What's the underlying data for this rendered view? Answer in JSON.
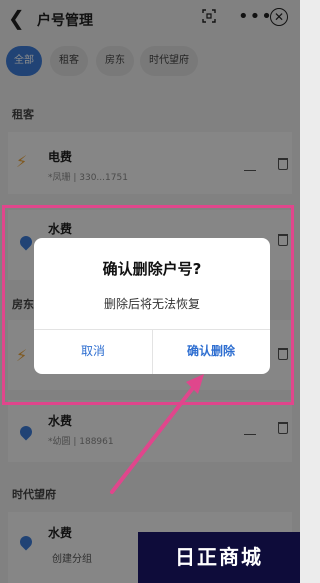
{
  "header": {
    "back_icon": "chevron-left-icon",
    "title": "户号管理",
    "scan_icon": "scan-icon",
    "more_icon": "more-icon",
    "close_icon": "close-circle-icon",
    "more_text": "•••",
    "close_text": "✕"
  },
  "chips": [
    "全部",
    "租客",
    "房东",
    "时代望府"
  ],
  "sections": {
    "zuke": "租客",
    "fangdong": "房东",
    "shidai": "时代望府"
  },
  "items": [
    {
      "name": "电费",
      "sub": "*凤珊 | 330...1751",
      "icon": "bolt-icon"
    },
    {
      "name": "水费",
      "sub": "",
      "icon": "water-drop-icon"
    },
    {
      "name": "水费",
      "sub": "*幼圆 | 188961",
      "icon": "water-drop-icon"
    },
    {
      "name": "水费",
      "sub": "",
      "icon": "water-drop-icon"
    }
  ],
  "footer": {
    "create_group": "创建分组"
  },
  "dialog": {
    "title": "确认删除户号?",
    "message": "删除后将无法恢复",
    "cancel": "取消",
    "confirm": "确认删除"
  },
  "watermark": "日正商城",
  "colors": {
    "accent": "#3d7bd6",
    "highlight": "#e0468c",
    "bolt": "#e8a23b"
  }
}
